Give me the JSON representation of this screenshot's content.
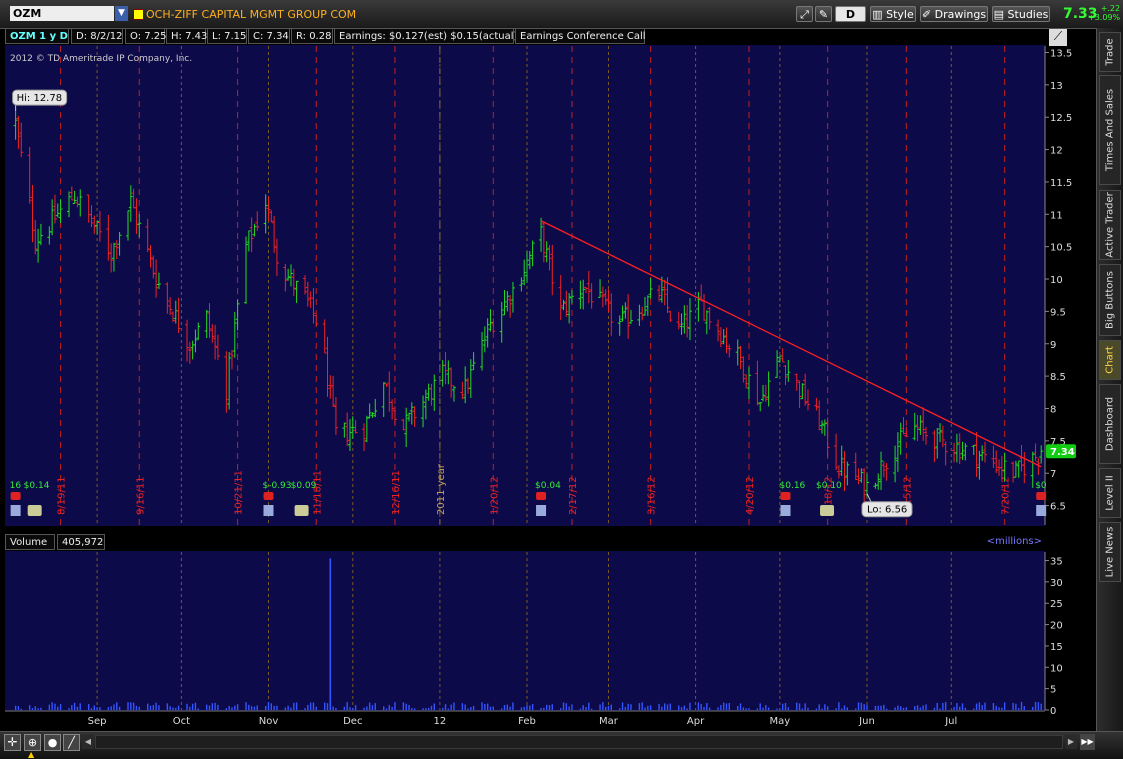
{
  "header": {
    "symbol": "OZM",
    "company": "OCH-ZIFF CAPITAL MGMT GROUP COM",
    "aggregation": "D",
    "style_label": "Style",
    "drawings_label": "Drawings",
    "studies_label": "Studies",
    "last_price": "7.33",
    "net_change": "+.22",
    "pct_change": "+3.09%"
  },
  "sidebar": {
    "tabs": [
      "Trade",
      "Times And Sales",
      "Active Trader",
      "Big Buttons",
      "Chart",
      "Dashboard",
      "Level II",
      "Live News"
    ],
    "active": "Chart"
  },
  "info_bar": {
    "title": "OZM 1 y D",
    "date": "D: 8/2/12",
    "open": "O: 7.25",
    "high": "H: 7.43",
    "low": "L: 7.15",
    "close": "C: 7.34",
    "range": "R: 0.28",
    "earnings": "Earnings: $0.127(est) $0.15(actual)",
    "event": "Earnings Conference Call"
  },
  "copyright": "2012 © TD Ameritrade IP Company, Inc.",
  "volume_panel": {
    "label": "Volume",
    "value": "405,972",
    "units": "<millions>"
  },
  "colors": {
    "panel_bg": "#0d0a4a",
    "up": "#22dd22",
    "down": "#ee2222",
    "trendline": "#ff2020",
    "volume": "#3355ff",
    "accent": "#ffb020"
  },
  "chart_data": {
    "type": "ohlc",
    "price_axis": {
      "ylim": [
        6.2,
        13.6
      ],
      "ticks": [
        6.5,
        7,
        7.5,
        8,
        8.5,
        9,
        9.5,
        10,
        10.5,
        11,
        11.5,
        12,
        12.5,
        13,
        13.5
      ],
      "last_price_label": "7.34"
    },
    "x_axis": {
      "labels": [
        "Sep",
        "Oct",
        "Nov",
        "Dec",
        "12",
        "Feb",
        "Mar",
        "Apr",
        "May",
        "Jun",
        "Jul"
      ]
    },
    "date_markers": [
      "8/19/11",
      "9/16/11",
      "10/21/11",
      "11/18/11",
      "12/16/11",
      "2011 year",
      "1/20/12",
      "2/17/12",
      "3/16/12",
      "4/20/12",
      "5/18/12",
      "6/15/12",
      "7/20/12"
    ],
    "annotations": [
      {
        "text": "Hi: 12.78",
        "value": 12.78
      },
      {
        "text": "Lo: 6.56",
        "value": 6.56
      }
    ],
    "events": [
      "16",
      "$0.14",
      "$-0.93",
      "$0.09",
      "$0.04",
      "$0.16",
      "$0.10",
      "$0"
    ],
    "trendline": {
      "start": {
        "date": "2012-02-06",
        "price": 10.9
      },
      "end": {
        "date": "2012-08-02",
        "price": 7.1
      }
    },
    "anchors": [
      {
        "date": "2011-08-03",
        "price": 12.4
      },
      {
        "date": "2011-08-10",
        "price": 10.6
      },
      {
        "date": "2011-08-24",
        "price": 11.3
      },
      {
        "date": "2011-09-06",
        "price": 10.4
      },
      {
        "date": "2011-09-13",
        "price": 11.2
      },
      {
        "date": "2011-09-22",
        "price": 10.0
      },
      {
        "date": "2011-10-04",
        "price": 9.0
      },
      {
        "date": "2011-10-10",
        "price": 9.4
      },
      {
        "date": "2011-10-17",
        "price": 8.3
      },
      {
        "date": "2011-10-24",
        "price": 10.5
      },
      {
        "date": "2011-10-31",
        "price": 11.2
      },
      {
        "date": "2011-11-05",
        "price": 10.2
      },
      {
        "date": "2011-11-14",
        "price": 9.7
      },
      {
        "date": "2011-11-19",
        "price": 9.3
      },
      {
        "date": "2011-11-25",
        "price": 7.6
      },
      {
        "date": "2011-12-05",
        "price": 7.7
      },
      {
        "date": "2011-12-12",
        "price": 8.4
      },
      {
        "date": "2011-12-19",
        "price": 7.7
      },
      {
        "date": "2012-01-02",
        "price": 8.5
      },
      {
        "date": "2012-01-10",
        "price": 8.3
      },
      {
        "date": "2012-01-19",
        "price": 9.3
      },
      {
        "date": "2012-01-28",
        "price": 9.9
      },
      {
        "date": "2012-02-06",
        "price": 10.7
      },
      {
        "date": "2012-02-13",
        "price": 9.5
      },
      {
        "date": "2012-02-21",
        "price": 9.9
      },
      {
        "date": "2012-03-05",
        "price": 9.3
      },
      {
        "date": "2012-03-19",
        "price": 9.8
      },
      {
        "date": "2012-03-26",
        "price": 9.2
      },
      {
        "date": "2012-04-03",
        "price": 9.6
      },
      {
        "date": "2012-04-16",
        "price": 8.8
      },
      {
        "date": "2012-04-24",
        "price": 8.1
      },
      {
        "date": "2012-05-01",
        "price": 8.8
      },
      {
        "date": "2012-05-15",
        "price": 7.8
      },
      {
        "date": "2012-05-22",
        "price": 7.1
      },
      {
        "date": "2012-06-01",
        "price": 6.8
      },
      {
        "date": "2012-06-11",
        "price": 7.4
      },
      {
        "date": "2012-06-18",
        "price": 7.7
      },
      {
        "date": "2012-06-27",
        "price": 7.5
      },
      {
        "date": "2012-07-10",
        "price": 7.3
      },
      {
        "date": "2012-07-24",
        "price": 7.0
      },
      {
        "date": "2012-08-02",
        "price": 7.33
      }
    ],
    "volume_axis": {
      "ylim": [
        0,
        37
      ],
      "ticks": [
        0,
        5,
        10,
        15,
        20,
        25,
        30,
        35
      ]
    },
    "volume_spike": {
      "date": "2011-11-23",
      "value": 35.5
    }
  }
}
